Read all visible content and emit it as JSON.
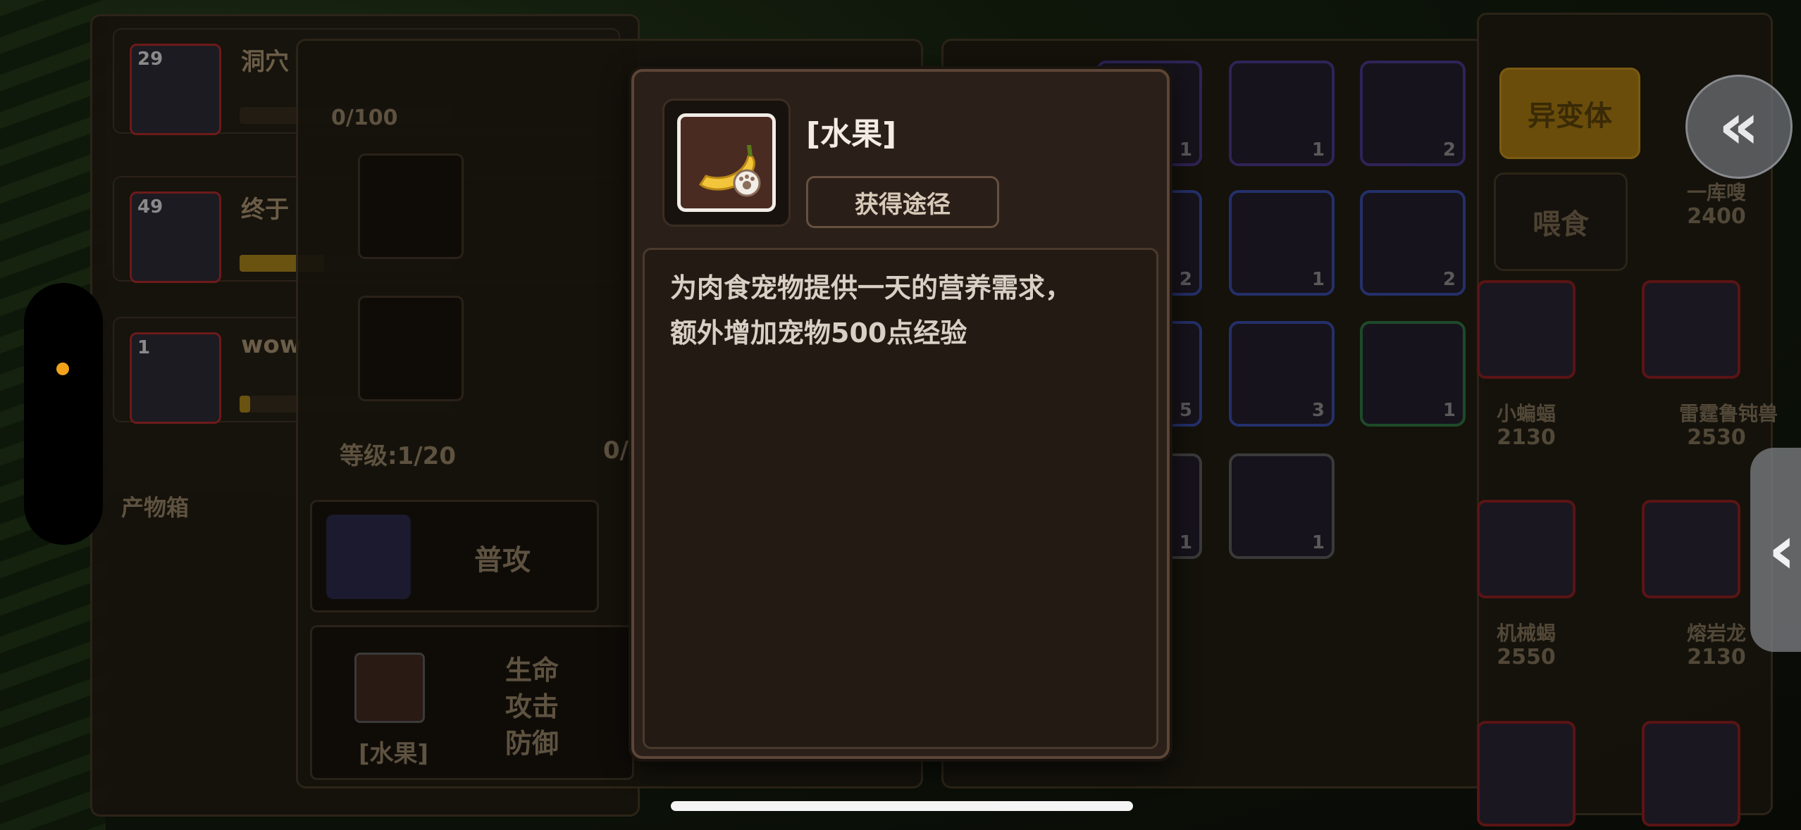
{
  "modal": {
    "item_title": "[水果]",
    "source_button": "获得途径",
    "description_line1": "为肉食宠物提供一天的营养需求，",
    "description_line2": "额外增加宠物500点经验"
  },
  "pets": [
    {
      "level": "29",
      "name": "洞穴"
    },
    {
      "level": "49",
      "name": "终于"
    },
    {
      "level": "1",
      "name": "wow"
    }
  ],
  "left_panel": {
    "products_box": "产物箱"
  },
  "middle_panel": {
    "exp_text": "0/100",
    "level_text": "等级:1/20",
    "progress_text": "0/",
    "attack_label": "普攻",
    "food_label": "[水果]",
    "stat_hp": "生命",
    "stat_atk": "攻击",
    "stat_def": "防御"
  },
  "inventory_counts": [
    "1",
    "1",
    "2",
    "2",
    "1",
    "2",
    "5",
    "3",
    "1",
    "1",
    "1"
  ],
  "right_panel": {
    "mutant_button": "异变体",
    "feed_button": "喂食",
    "pets": [
      {
        "name": "一库嗖",
        "value": "2400"
      },
      {
        "name": "小蝙蝠",
        "value": "2130"
      },
      {
        "name": "雷霆鲁钝兽",
        "value": "2530"
      },
      {
        "name": "机械蝎",
        "value": "2550"
      },
      {
        "name": "熔岩龙",
        "value": "2130"
      }
    ]
  },
  "colors": {
    "accent": "#f1a21a",
    "modal_bg": "#2a2019",
    "modal_border": "#5b4536"
  }
}
